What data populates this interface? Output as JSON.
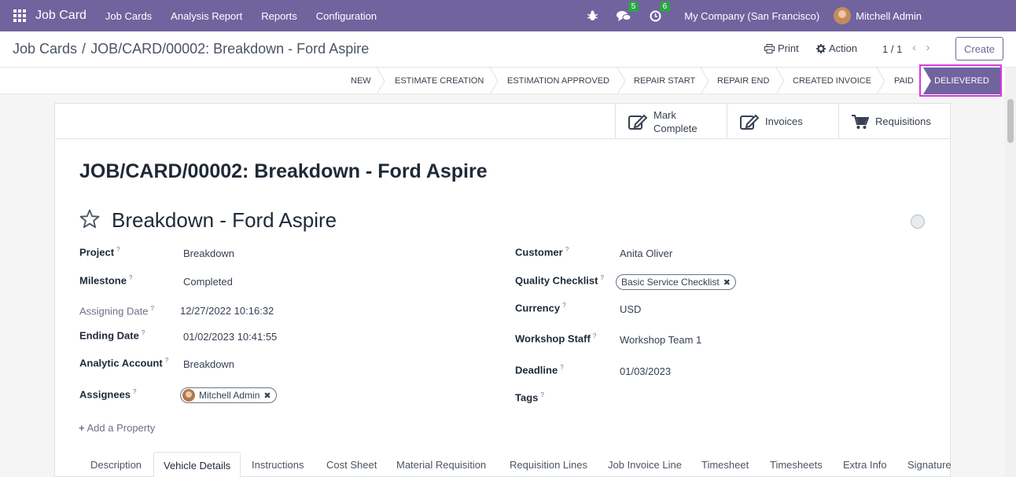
{
  "navbar": {
    "app_name": "Job Card",
    "menu": [
      "Job Cards",
      "Analysis Report",
      "Reports",
      "Configuration"
    ],
    "chat_count": "5",
    "activity_count": "6",
    "company": "My Company (San Francisco)",
    "user": "Mitchell Admin",
    "accent": "#71639e"
  },
  "control": {
    "breadcrumb_root": "Job Cards",
    "breadcrumb_sep": "/",
    "breadcrumb_current": "JOB/CARD/00002: Breakdown - Ford Aspire",
    "print_label": "Print",
    "action_label": "Action",
    "pager": "1 / 1",
    "create_label": "Create"
  },
  "stages": [
    "NEW",
    "ESTIMATE CREATION",
    "ESTIMATION APPROVED",
    "REPAIR START",
    "REPAIR END",
    "CREATED INVOICE",
    "PAID"
  ],
  "active_stage": "DELIEVERED",
  "smart_buttons": {
    "mark_complete_1": "Mark",
    "mark_complete_2": "Complete",
    "invoices": "Invoices",
    "requisitions": "Requisitions"
  },
  "record": {
    "title": "JOB/CARD/00002: Breakdown - Ford Aspire",
    "name": "Breakdown - Ford Aspire"
  },
  "fields": {
    "project_label": "Project",
    "project": "Breakdown",
    "milestone_label": "Milestone",
    "milestone": "Completed",
    "assigning_date_label": "Assigning Date",
    "assigning_date": "12/27/2022 10:16:32",
    "ending_date_label": "Ending Date",
    "ending_date": "01/02/2023 10:41:55",
    "analytic_account_label": "Analytic Account",
    "analytic_account": "Breakdown",
    "assignees_label": "Assignees",
    "assignee": "Mitchell Admin",
    "customer_label": "Customer",
    "customer": "Anita Oliver",
    "quality_checklist_label": "Quality Checklist",
    "quality_checklist": "Basic Service Checklist",
    "currency_label": "Currency",
    "currency": "USD",
    "workshop_staff_label": "Workshop Staff",
    "workshop_staff": "Workshop Team 1",
    "deadline_label": "Deadline",
    "deadline": "01/03/2023",
    "tags_label": "Tags",
    "help_mark": "?",
    "add_property": "Add a Property"
  },
  "tabs": [
    "Description",
    "Vehicle Details",
    "Instructions",
    "Cost Sheet",
    "Material Requisition",
    "Requisition Lines",
    "Job Invoice Line",
    "Timesheet",
    "Timesheets",
    "Extra Info",
    "Signature"
  ],
  "active_tab": "Vehicle Details"
}
